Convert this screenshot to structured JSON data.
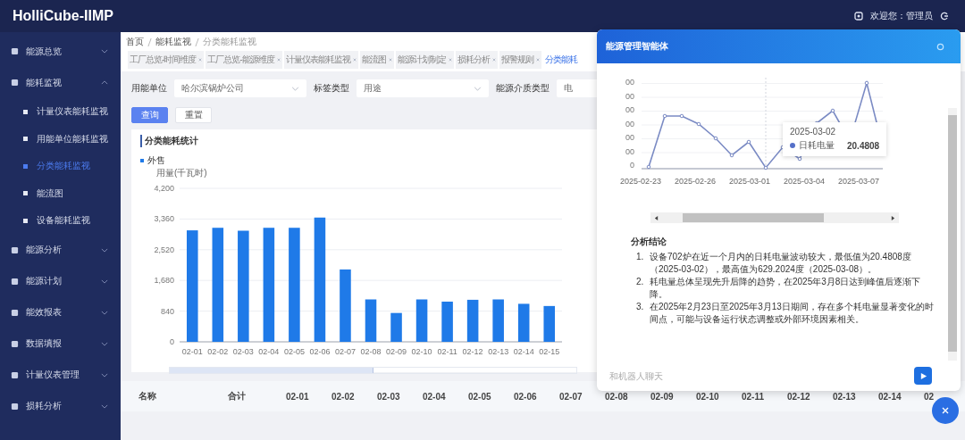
{
  "app": {
    "title": "HolliCube-IIMP",
    "welcome": "欢迎您：管理员"
  },
  "sidebar": {
    "items": [
      {
        "label": "能源总览",
        "expanded": false
      },
      {
        "label": "能耗监视",
        "expanded": true,
        "children": [
          {
            "label": "计量仪表能耗监视",
            "selected": false
          },
          {
            "label": "用能单位能耗监视",
            "selected": false
          },
          {
            "label": "分类能耗监视",
            "selected": true
          },
          {
            "label": "能流图",
            "selected": false
          },
          {
            "label": "设备能耗监视",
            "selected": false
          }
        ]
      },
      {
        "label": "能源分析",
        "expanded": false
      },
      {
        "label": "能源计划",
        "expanded": false
      },
      {
        "label": "能效报表",
        "expanded": false
      },
      {
        "label": "数据填报",
        "expanded": false
      },
      {
        "label": "计量仪表管理",
        "expanded": false
      },
      {
        "label": "损耗分析",
        "expanded": false
      }
    ]
  },
  "breadcrumb": [
    "首页",
    "能耗监视",
    "分类能耗监视"
  ],
  "tabs": [
    {
      "label": "工厂总览-时间维度",
      "selected": false
    },
    {
      "label": "工厂总览-能源维度",
      "selected": false
    },
    {
      "label": "计量仪表能耗监视",
      "selected": false
    },
    {
      "label": "能流图",
      "selected": false
    },
    {
      "label": "能源计划制定",
      "selected": false
    },
    {
      "label": "损耗分析",
      "selected": false
    },
    {
      "label": "报警规则",
      "selected": false
    },
    {
      "label": "分类能耗",
      "selected": true
    }
  ],
  "filters": [
    {
      "label": "用能单位",
      "value": "哈尔滨锅炉公司"
    },
    {
      "label": "标签类型",
      "value": "用途"
    },
    {
      "label": "能源介质类型",
      "value": "电"
    }
  ],
  "buttons": [
    {
      "label": "查询",
      "kind": "primary"
    },
    {
      "label": "重置",
      "kind": "default"
    }
  ],
  "chart_card": {
    "title": "分类能耗统计",
    "zoom_slider": {
      "level": 0.5
    },
    "chart_data": {
      "type": "bar",
      "ylabel": "用量(千瓦时)",
      "grid": true,
      "categories": [
        "02-01",
        "02-02",
        "02-03",
        "02-04",
        "02-05",
        "02-06",
        "02-07",
        "02-08",
        "02-09",
        "02-10",
        "02-11",
        "02-12",
        "02-13",
        "02-14",
        "02-15"
      ],
      "series": [
        {
          "name": "外售",
          "color": "#1f7ae8",
          "values": [
            3050,
            3120,
            3040,
            3120,
            3120,
            3400,
            1980,
            1160,
            790,
            1160,
            1100,
            1150,
            1160,
            1040,
            980
          ]
        }
      ],
      "ylim": [
        0,
        4200
      ],
      "yticks": [
        {
          "value": 0,
          "label": "0"
        },
        {
          "value": 840,
          "label": "840"
        },
        {
          "value": 1680,
          "label": "1,680"
        },
        {
          "value": 2520,
          "label": "2,520"
        },
        {
          "value": 3360,
          "label": "3,360"
        },
        {
          "value": 4200,
          "label": "4,200"
        }
      ]
    }
  },
  "table": {
    "columns": [
      "名称",
      "合计",
      "02-01",
      "02-02",
      "02-03",
      "02-04",
      "02-05",
      "02-06",
      "02-07",
      "02-08",
      "02-09",
      "02-10",
      "02-11",
      "02-12",
      "02-13",
      "02-14",
      "02"
    ]
  },
  "assistant": {
    "title": "能源管理智能体",
    "trend": {
      "y_tick_labels": [
        "00",
        "00",
        "00",
        "00",
        "00",
        "00",
        "0"
      ],
      "x_labels": [
        "2025-02-23",
        "2025-02-26",
        "2025-03-01",
        "2025-03-04",
        "2025-03-07"
      ],
      "tooltip": {
        "date": "2025-03-02",
        "series": "日耗电量",
        "value": "20.4808"
      }
    },
    "analysis_title": "分析结论",
    "analysis": [
      {
        "number": "1.",
        "text": "设备702炉在近一个月内的日耗电量波动较大，最低值为20.4808度（2025-03-02），最高值为629.2024度（2025-03-08）。"
      },
      {
        "number": "2.",
        "text": "耗电量总体呈现先升后降的趋势，在2025年3月8日达到峰值后逐渐下降。"
      },
      {
        "number": "3.",
        "text": "在2025年2月23日至2025年3月13日期间，存在多个耗电量显著变化的时间点，可能与设备运行状态调整或外部环境因素相关。"
      }
    ],
    "input_placeholder": "和机器人聊天"
  }
}
